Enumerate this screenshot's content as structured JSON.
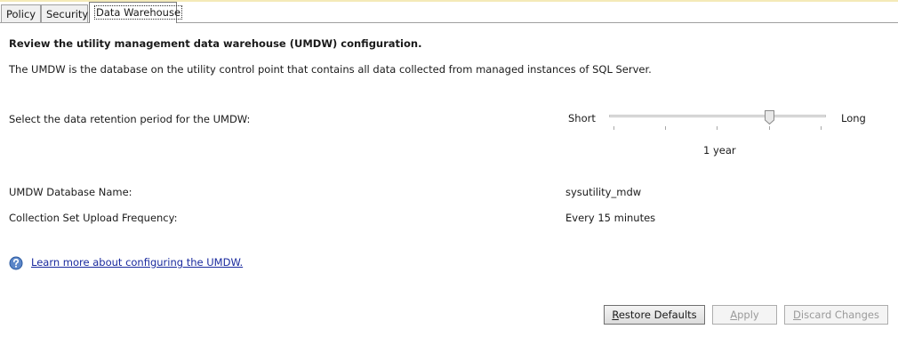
{
  "tabs": [
    {
      "label": "Policy"
    },
    {
      "label": "Security"
    },
    {
      "label": "Data Warehouse"
    }
  ],
  "main": {
    "heading": "Review the utility management data warehouse (UMDW) configuration.",
    "description": "The UMDW is the database on the utility control point that contains all data collected from managed instances of SQL Server."
  },
  "retention": {
    "label": "Select the data retention period for the UMDW:",
    "min_label": "Short",
    "max_label": "Long",
    "value_label": "1 year",
    "tick_count": 5,
    "selected_tick_index": 3
  },
  "details": [
    {
      "label": "UMDW Database Name:",
      "value": "sysutility_mdw"
    },
    {
      "label": "Collection Set Upload Frequency:",
      "value": "Every 15 minutes"
    }
  ],
  "help": {
    "icon": "help-icon",
    "link_text": "Learn more about configuring the UMDW."
  },
  "buttons": {
    "restore_first": "R",
    "restore_rest": "estore Defaults",
    "apply_first": "A",
    "apply_rest": "pply",
    "discard_first": "D",
    "discard_rest": "iscard Changes"
  },
  "colors": {
    "link": "#1a2a9e",
    "disabled_text": "#9a9a9a"
  }
}
